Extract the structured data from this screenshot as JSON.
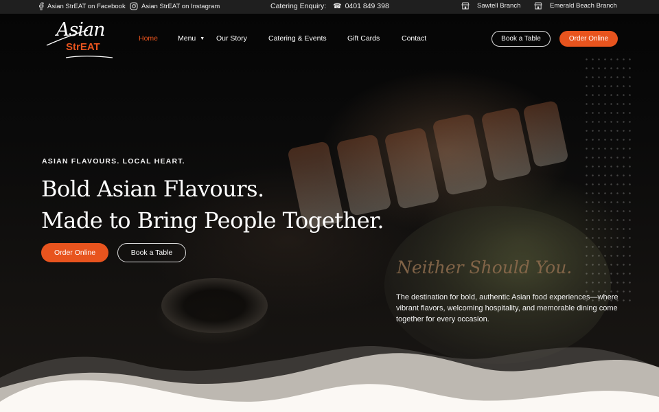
{
  "topbar": {
    "facebook": {
      "icon": "facebook-icon",
      "label": "Asian StrEAT on Facebook"
    },
    "instagram": {
      "icon": "instagram-icon",
      "label": "Asian StrEAT on Instagram"
    },
    "catering_label": "Catering Enquiry:",
    "phone_icon": "phone-icon",
    "phone": "0401 849 398",
    "branches": [
      {
        "icon": "store-icon",
        "label": "Sawtell Branch"
      },
      {
        "icon": "store-icon",
        "label": "Emerald Beach Branch"
      }
    ]
  },
  "logo": {
    "line1": "Asian",
    "line2": "StrEAT"
  },
  "nav": {
    "items": [
      {
        "label": "Home",
        "active": true
      },
      {
        "label": "Menu",
        "dropdown": true
      },
      {
        "label": "Our Story"
      },
      {
        "label": "Catering & Events"
      },
      {
        "label": "Gift Cards"
      },
      {
        "label": "Contact"
      }
    ],
    "book_label": "Book a Table",
    "order_label": "Order Online"
  },
  "hero": {
    "kicker": "ASIAN FLAVOURS. LOCAL HEART.",
    "headline_line1": "Bold Asian Flavours.",
    "headline_line2": "Made to Bring People Together.",
    "order_label": "Order Online",
    "book_label": "Book a Table",
    "script_text": "Neither Should You.",
    "description": "The destination for bold, authentic Asian food experiences—where vibrant flavors, welcoming hospitality, and memorable dining come together for every occasion."
  },
  "colors": {
    "accent": "#e8541e",
    "topbar": "#1f1f1f",
    "cream": "#fbf8f4",
    "wave_gray": "#bdb8b1"
  }
}
